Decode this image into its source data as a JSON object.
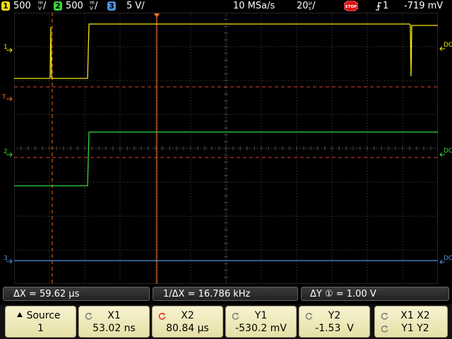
{
  "status": {
    "ch1": {
      "num": "1",
      "scale": "500",
      "unit_top": "m",
      "unit_bottom": "V",
      "color": "#f5e50f"
    },
    "ch2": {
      "num": "2",
      "scale": "500",
      "unit_top": "m",
      "unit_bottom": "V",
      "color": "#37d63a"
    },
    "ch3": {
      "num": "3",
      "scale": "5 V/",
      "color": "#4f92e0"
    },
    "sample_rate": "10 MSa/s",
    "timebase": "20",
    "timebase_unit_top": "µ",
    "timebase_unit_bottom": "s",
    "run_state": "STOP",
    "trigger_source": "1",
    "trigger_level": "-719 mV"
  },
  "screen": {
    "ch1_marker": "1",
    "ch2_marker": "2",
    "ch3_marker": "3",
    "trigger_marker": "T",
    "dc_label": "DC"
  },
  "measurements": {
    "delta_x": "ΔX = 59.62 µs",
    "inv_delta_x": "1/ΔX = 16.786 kHz",
    "delta_y": "ΔY ① = 1.00 V"
  },
  "softkeys": {
    "source": {
      "label": "Source",
      "value": "1"
    },
    "x1": {
      "label": "X1",
      "value": "53.02 ns"
    },
    "x2": {
      "label": "X2",
      "value": "80.84 µs"
    },
    "y1": {
      "label": "Y1",
      "value": "-530.2 mV"
    },
    "y2": {
      "label": "Y2",
      "value": "-1.53  V"
    },
    "xy": {
      "row1": "X1 X2",
      "row2": "Y1 Y2"
    }
  },
  "colors": {
    "ch1": "#f5e50f",
    "ch2": "#37d63a",
    "ch3": "#4f92e0",
    "trigger": "#f07020",
    "cursor_x": "#f07020",
    "cursor_y": "#e04030",
    "grid": "#4a4a4a"
  }
}
